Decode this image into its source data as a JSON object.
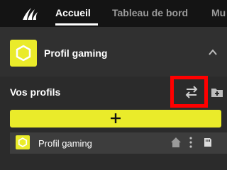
{
  "nav": {
    "tabs": [
      {
        "label": "Accueil",
        "active": true
      },
      {
        "label": "Tableau de bord",
        "active": false
      },
      {
        "label": "Mu",
        "active": false
      }
    ]
  },
  "current_profile": {
    "name": "Profil gaming",
    "icon": "hexagon-profile-icon",
    "expanded": true
  },
  "profiles_section": {
    "title": "Vos profils",
    "actions": [
      "swap-arrows-icon",
      "import-icon"
    ],
    "add_label": "+"
  },
  "profiles_list": [
    {
      "name": "Profil gaming",
      "icon": "hexagon-profile-icon",
      "actions": [
        "home-icon",
        "more-vertical-icon",
        "device-memory-icon"
      ]
    }
  ],
  "colors": {
    "accent": "#eaeb2a",
    "highlight": "#ff0000",
    "background": "#2b2b2b",
    "topbar": "#141414"
  }
}
